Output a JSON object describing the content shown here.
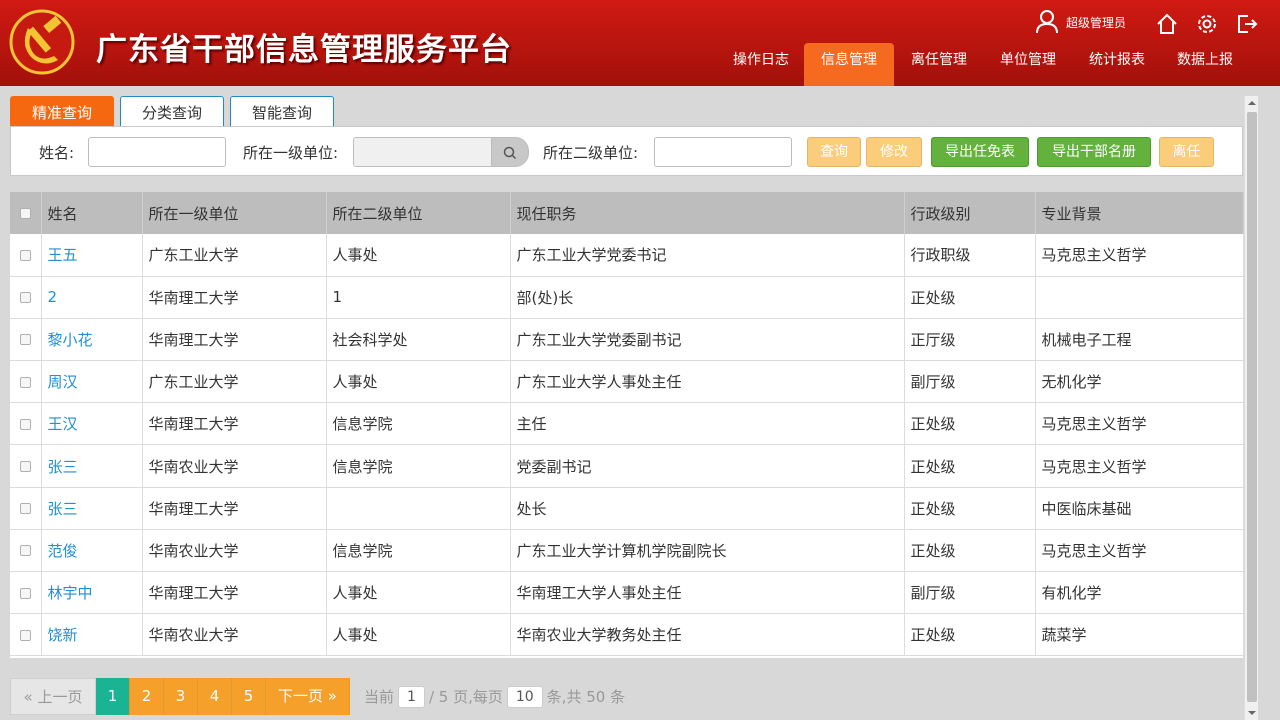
{
  "header": {
    "title": "广东省干部信息管理服务平台",
    "user": "超级管理员",
    "logo_icon": "hammer-sickle-icon",
    "nav": [
      {
        "label": "操作日志",
        "active": false
      },
      {
        "label": "信息管理",
        "active": true
      },
      {
        "label": "离任管理",
        "active": false
      },
      {
        "label": "单位管理",
        "active": false
      },
      {
        "label": "统计报表",
        "active": false
      },
      {
        "label": "数据上报",
        "active": false
      }
    ]
  },
  "tabs": [
    {
      "label": "精准查询",
      "active": true
    },
    {
      "label": "分类查询",
      "active": false
    },
    {
      "label": "智能查询",
      "active": false
    }
  ],
  "search": {
    "name_label": "姓名:",
    "name_value": "",
    "unit1_label": "所在一级单位:",
    "unit1_value": "",
    "unit2_label": "所在二级单位:",
    "unit2_value": "",
    "query_btn": "查询",
    "edit_btn": "修改",
    "export_appoint_btn": "导出任免表",
    "export_roster_btn": "导出干部名册",
    "leave_btn": "离任"
  },
  "table": {
    "columns": [
      "姓名",
      "所在一级单位",
      "所在二级单位",
      "现任职务",
      "行政级别",
      "专业背景"
    ],
    "rows": [
      [
        "王五",
        "广东工业大学",
        "人事处",
        "广东工业大学党委书记",
        "行政职级",
        "马克思主义哲学"
      ],
      [
        "2",
        "华南理工大学",
        "1",
        "部(处)长",
        "正处级",
        ""
      ],
      [
        "黎小花",
        "华南理工大学",
        "社会科学处",
        "广东工业大学党委副书记",
        "正厅级",
        "机械电子工程"
      ],
      [
        "周汉",
        "广东工业大学",
        "人事处",
        "广东工业大学人事处主任",
        "副厅级",
        "无机化学"
      ],
      [
        "王汉",
        "华南理工大学",
        "信息学院",
        "主任",
        "正处级",
        "马克思主义哲学"
      ],
      [
        "张三",
        "华南农业大学",
        "信息学院",
        "党委副书记",
        "正处级",
        "马克思主义哲学"
      ],
      [
        "张三",
        "华南理工大学",
        "",
        "处长",
        "正处级",
        "中医临床基础"
      ],
      [
        "范俊",
        "华南农业大学",
        "信息学院",
        "广东工业大学计算机学院副院长",
        "正处级",
        "马克思主义哲学"
      ],
      [
        "林宇中",
        "华南理工大学",
        "人事处",
        "华南理工大学人事处主任",
        "副厅级",
        "有机化学"
      ],
      [
        "饶新",
        "华南农业大学",
        "人事处",
        "华南农业大学教务处主任",
        "正处级",
        "蔬菜学"
      ]
    ]
  },
  "pager": {
    "prev": "« 上一页",
    "pages": [
      "1",
      "2",
      "3",
      "4",
      "5"
    ],
    "current": "1",
    "next": "下一页 »",
    "current_label": "当前",
    "current_page": "1",
    "total_label": "/ 5 页,每页",
    "per_page": "10",
    "total_suffix": "条,共 50 条"
  },
  "colors": {
    "header_red": "#c0150f",
    "accent_orange": "#f5680f",
    "link_blue": "#1f8fd6",
    "green": "#62b23d",
    "pager_current": "#1ab394"
  }
}
